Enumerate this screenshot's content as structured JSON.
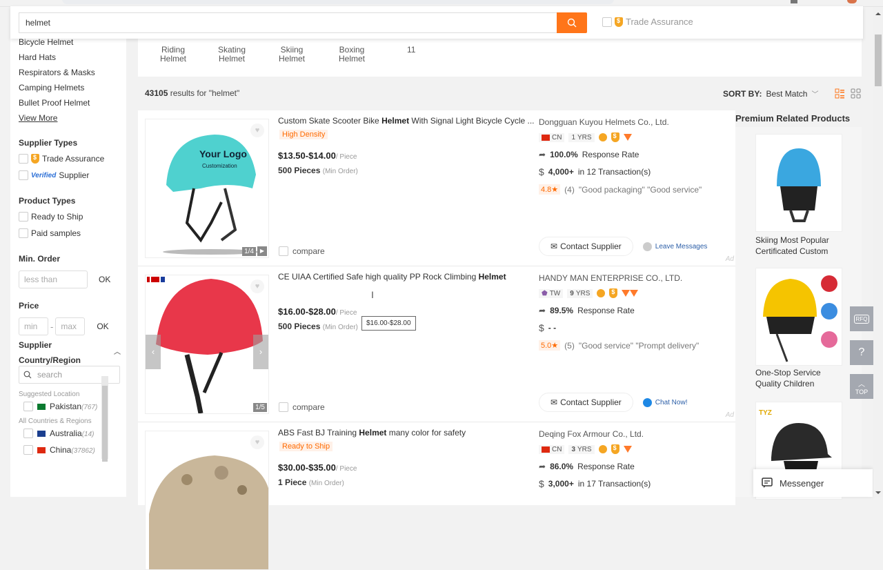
{
  "search": {
    "value": "helmet",
    "trade_assurance_label": "Trade Assurance"
  },
  "sidebar": {
    "categories": [
      "Bicycle Helmet",
      "Hard Hats",
      "Respirators & Masks",
      "Camping Helmets",
      "Bullet Proof Helmet"
    ],
    "view_more": "View More",
    "supplier_types_heading": "Supplier Types",
    "supplier_types": {
      "trade_assurance": "Trade Assurance",
      "verified_badge": "Verified",
      "verified_label": "Supplier"
    },
    "product_types_heading": "Product Types",
    "product_types": [
      "Ready to Ship",
      "Paid samples"
    ],
    "min_order_heading": "Min. Order",
    "min_order_placeholder": "less than",
    "ok": "OK",
    "price_heading": "Price",
    "price_min_placeholder": "min",
    "price_max_placeholder": "max",
    "price_sep": "-",
    "country_heading": "Supplier Country/Region",
    "country_search_placeholder": "search",
    "suggested_label": "Suggested Location",
    "suggested": [
      {
        "name": "Pakistan",
        "count": "(767)"
      }
    ],
    "all_label": "All Countries & Regions",
    "countries": [
      {
        "name": "Australia",
        "count": "(14)"
      },
      {
        "name": "China",
        "count": "(37862)"
      }
    ]
  },
  "related_searches": [
    {
      "line1": "Riding",
      "line2": "Helmet"
    },
    {
      "line1": "Skating",
      "line2": "Helmet"
    },
    {
      "line1": "Skiing",
      "line2": "Helmet"
    },
    {
      "line1": "Boxing",
      "line2": "Helmet"
    },
    {
      "line1": "11",
      "line2": ""
    }
  ],
  "results": {
    "count": "43105",
    "text": " results for \"helmet\"",
    "sort_label": "SORT BY:",
    "sort_value": "Best Match"
  },
  "products": [
    {
      "title_pre": "Custom Skate Scooter Bike ",
      "title_bold": "Helmet",
      "title_post": " With Signal Light Bicycle Cycle ...",
      "tag": "High Density",
      "price": "$13.50-$14.00",
      "unit": "/ Piece",
      "moq": "500 Pieces",
      "moq_note": "(Min Order)",
      "img_counter": "1/4",
      "image_text1": "Your Logo",
      "image_text2": "Customization",
      "compare": "compare",
      "supplier": "Dongguan Kuyou Helmets Co., Ltd.",
      "country": "CN",
      "years_num": "1",
      "years": "YRS",
      "response_rate": "100.0%",
      "response_label": "Response Rate",
      "transactions_bold": "4,000+",
      "transactions": " in 12 Transaction(s)",
      "rating": "4.8",
      "review_count": "(4)",
      "reviews": "\"Good packaging\"  \"Good service\"",
      "contact": "Contact Supplier",
      "message": "Leave Messages",
      "ad": "Ad"
    },
    {
      "title_pre": "CE UIAA Certified Safe high quality PP Rock Climbing ",
      "title_bold": "Helmet",
      "title_post": "",
      "tag": "",
      "price": "$16.00-$28.00",
      "unit": "/ Piece",
      "moq": "500 Pieces",
      "moq_note": "(Min Order)",
      "tooltip": "$16.00-$28.00",
      "img_counter": "1/5",
      "compare": "compare",
      "supplier": "HANDY MAN ENTERPRISE CO., LTD.",
      "country": "TW",
      "years_num": "9",
      "years": "YRS",
      "response_rate": "89.5%",
      "response_label": "Response Rate",
      "transactions_bold": "- -",
      "transactions": "",
      "rating": "5.0",
      "review_count": "(5)",
      "reviews": "\"Good service\"  \"Prompt delivery\"",
      "contact": "Contact Supplier",
      "message": "Chat Now!",
      "ad": "Ad"
    },
    {
      "title_pre": "ABS Fast BJ Training ",
      "title_bold": "Helmet",
      "title_post": " many color for safety",
      "tag": "Ready to Ship",
      "price": "$30.00-$35.00",
      "unit": "/ Piece",
      "moq": "1 Piece",
      "moq_note": "(Min Order)",
      "supplier": "Deqing Fox Armour Co., Ltd.",
      "country": "CN",
      "years_num": "3",
      "years": "YRS",
      "response_rate": "86.0%",
      "response_label": "Response Rate",
      "transactions_bold": "3,000+",
      "transactions": " in 17 Transaction(s)"
    }
  ],
  "premium": {
    "heading": "Premium Related Products",
    "items": [
      {
        "title1": "Skiing Most Popular",
        "title2": "Certificated Custom"
      },
      {
        "title1": "One-Stop Service",
        "title2": "Quality Children"
      },
      {
        "badge": "TYZ"
      }
    ]
  },
  "float_buttons": {
    "rfq": "RFQ",
    "top": "TOP"
  },
  "messenger": "Messenger"
}
